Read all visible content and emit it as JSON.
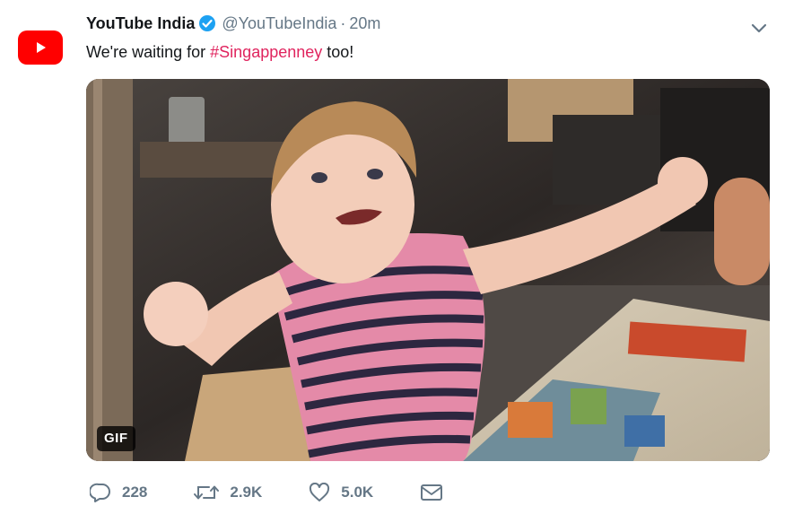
{
  "tweet": {
    "author_name": "YouTube India",
    "handle": "@YouTubeIndia",
    "separator": "·",
    "time": "20m",
    "text_before": "We're waiting for ",
    "hashtag": "#Singappenney",
    "text_after": " too!",
    "media_badge": "GIF"
  },
  "actions": {
    "replies": "228",
    "retweets": "2.9K",
    "likes": "5.0K"
  },
  "icons": {
    "avatar": "youtube-logo-icon",
    "verified": "verified-badge-icon",
    "menu": "chevron-down-icon",
    "reply": "reply-icon",
    "retweet": "retweet-icon",
    "like": "heart-icon",
    "dm": "envelope-icon"
  },
  "colors": {
    "avatar_bg": "#ff0000",
    "verified": "#1da1f2",
    "hashtag": "#e0245e",
    "secondary_text": "#657786"
  }
}
